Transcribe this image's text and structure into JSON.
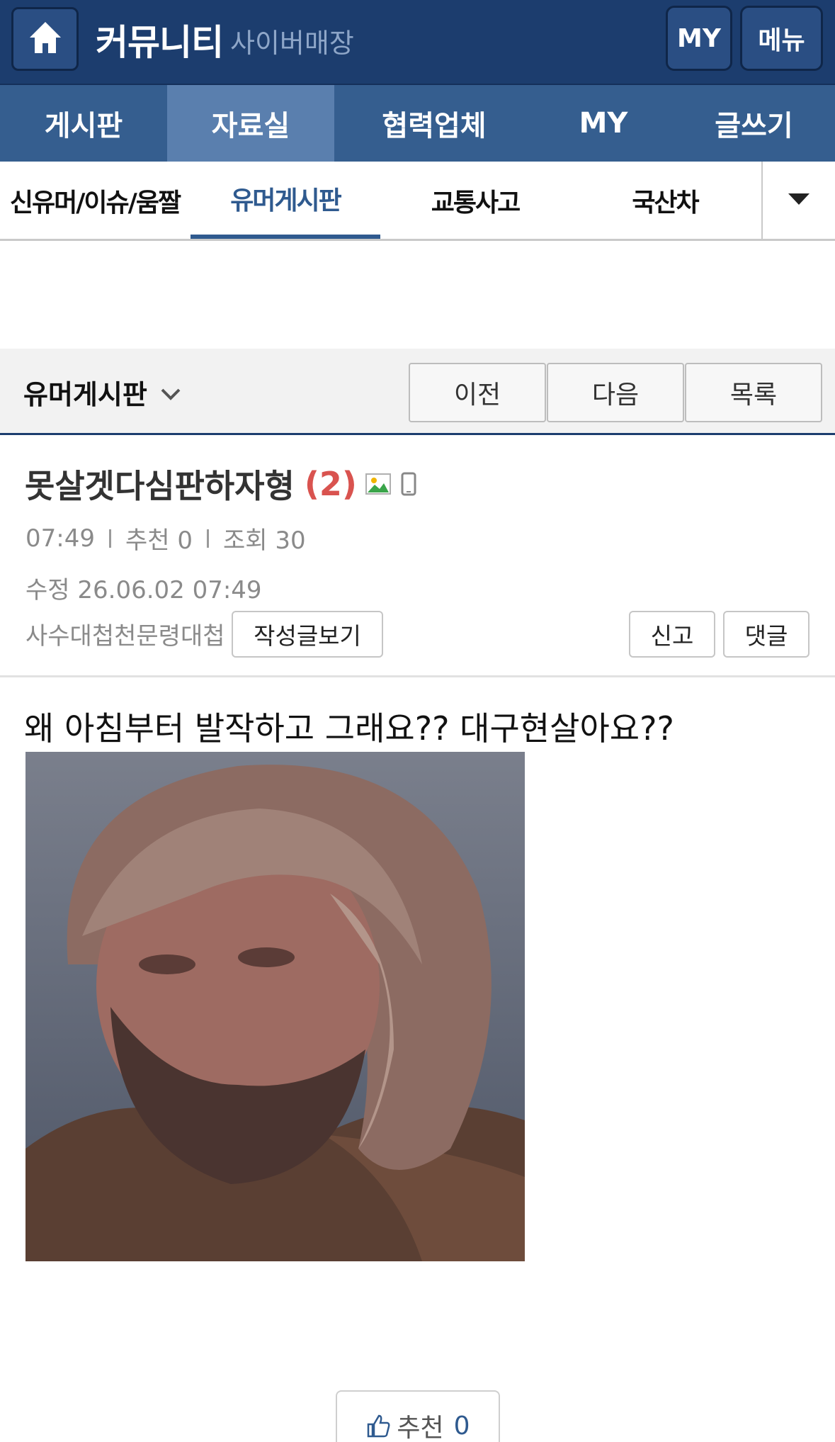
{
  "header": {
    "home_icon": "home-icon",
    "title": "커뮤니티",
    "subtitle": "사이버매장",
    "my_label": "MY",
    "menu_label": "메뉴",
    "bg_color": "#1c3d6e"
  },
  "nav_primary": {
    "items": [
      {
        "label": "게시판",
        "active": false
      },
      {
        "label": "자료실",
        "active": true
      },
      {
        "label": "협력업체",
        "active": false
      },
      {
        "label": "MY",
        "active": false
      },
      {
        "label": "글쓰기",
        "active": false
      }
    ]
  },
  "nav_secondary": {
    "tabs": [
      {
        "label": "신유머/이슈/움짤",
        "active": false
      },
      {
        "label": "유머게시판",
        "active": true
      },
      {
        "label": "교통사고",
        "active": false
      },
      {
        "label": "국산차",
        "active": false
      }
    ],
    "more_icon": "caret-down-icon",
    "accent_color": "#2f5a8f"
  },
  "board_bar": {
    "board_name": "유머게시판",
    "prev_label": "이전",
    "next_label": "다음",
    "list_label": "목록"
  },
  "post": {
    "title": "못살겟다심판하자형",
    "comment_count": "(2)",
    "time": "07:49",
    "recommend_text": "추천 0",
    "views_text": "조회 30",
    "edited_text": "수정 26.06.02  07:49",
    "author": "사수대첩천문령대첩",
    "view_posts_label": "작성글보기",
    "report_label": "신고",
    "comment_label": "댓글",
    "body_text": "왜 아침부터 발작하고 그래요?? 대구현살아요??",
    "image_icon": "image-icon",
    "mobile_icon": "mobile-icon"
  },
  "recommend": {
    "label": "추천",
    "count": "0",
    "icon": "thumbs-up-icon"
  }
}
